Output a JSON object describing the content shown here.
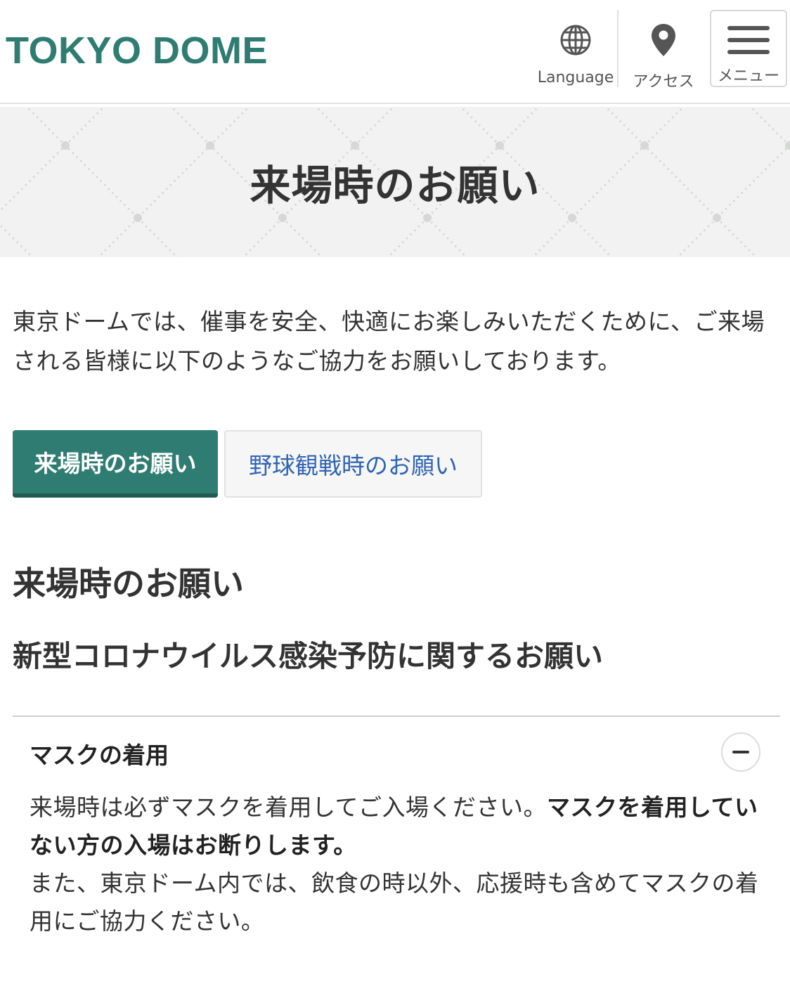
{
  "colors": {
    "brand": "#2f7d72",
    "tab_active_bg": "#2f7d72",
    "tab_active_shadow": "#205a53",
    "link_blue": "#2f64b4",
    "hero_bg": "#f1f2f1"
  },
  "header": {
    "logo_text": "TOKYO DOME",
    "language_label": "Language",
    "language_icon": "globe-icon",
    "access_label": "アクセス",
    "access_icon": "map-pin-icon",
    "menu_label": "メニュー",
    "menu_icon": "hamburger-icon"
  },
  "hero": {
    "title": "来場時のお願い"
  },
  "intro": {
    "text": "東京ドームでは、催事を安全、快適にお楽しみいただくために、ご来場される皆様に以下のようなご協力をお願いしております。"
  },
  "tabs": [
    {
      "label": "来場時のお願い",
      "active": true
    },
    {
      "label": "野球観戦時のお願い",
      "active": false
    }
  ],
  "section": {
    "heading": "来場時のお願い",
    "subheading": "新型コロナウイルス感染予防に関するお願い"
  },
  "accordion": {
    "title": "マスクの着用",
    "toggle_icon": "minus-icon",
    "body_part1": "来場時は必ずマスクを着用してご入場ください。",
    "body_bold": "マスクを着用していない方の入場はお断りします。",
    "body_part2": "また、東京ドーム内では、飲食の時以外、応援時も含めてマスクの着用にご協力ください。"
  }
}
